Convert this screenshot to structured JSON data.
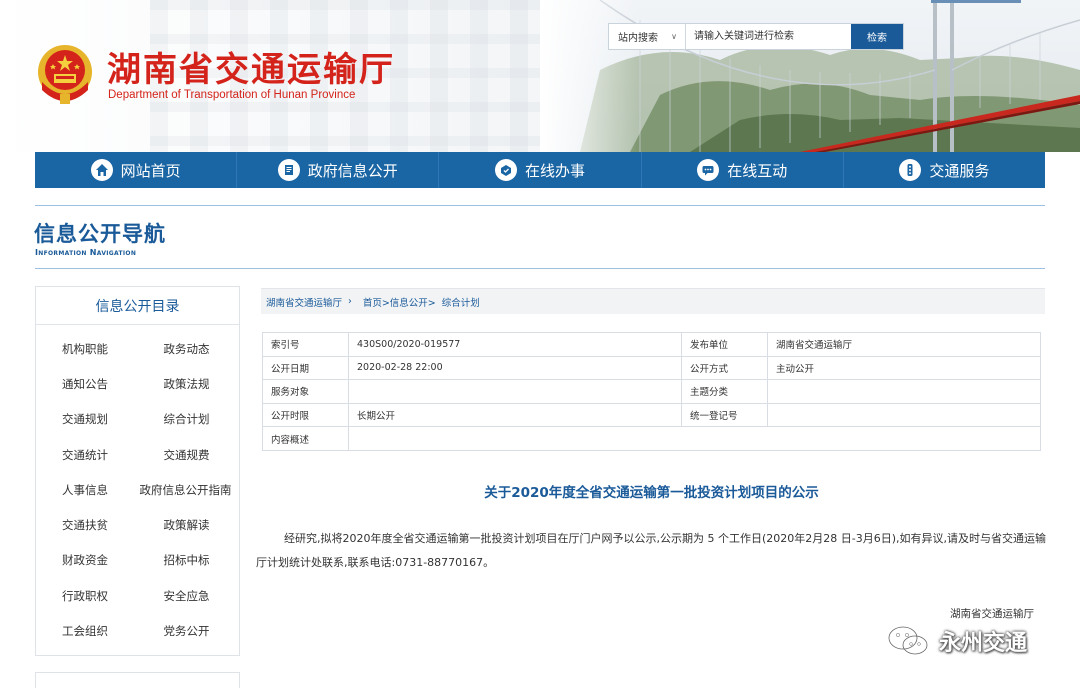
{
  "header": {
    "title": "湖南省交通运输厅",
    "subtitle": "Department of Transportation of Hunan Province"
  },
  "search": {
    "scope_label": "站内搜索",
    "placeholder": "请输入关键词进行检索",
    "button_label": "检索"
  },
  "nav": {
    "items": [
      {
        "label": "网站首页",
        "icon": "home-icon"
      },
      {
        "label": "政府信息公开",
        "icon": "document-icon"
      },
      {
        "label": "在线办事",
        "icon": "service-icon"
      },
      {
        "label": "在线互动",
        "icon": "chat-icon"
      },
      {
        "label": "交通服务",
        "icon": "traffic-light-icon"
      }
    ]
  },
  "section": {
    "title": "信息公开导航",
    "subtitle": "Information Navigation"
  },
  "sidebar": {
    "title": "信息公开目录",
    "items": [
      "机构职能",
      "政务动态",
      "通知公告",
      "政策法规",
      "交通规划",
      "综合计划",
      "交通统计",
      "交通规费",
      "人事信息",
      "政府信息公开指南",
      "交通扶贫",
      "政策解读",
      "财政资金",
      "招标中标",
      "行政职权",
      "安全应急",
      "工会组织",
      "党务公开"
    ]
  },
  "breadcrumb": {
    "items": [
      "湖南省交通运输厅",
      "首页>信息公开>  综合计划"
    ]
  },
  "info_table": {
    "rows": [
      {
        "k1": "索引号",
        "v1": "430S00/2020-019577",
        "k2": "发布单位",
        "v2": "湖南省交通运输厅"
      },
      {
        "k1": "公开日期",
        "v1": "2020-02-28 22:00",
        "k2": "公开方式",
        "v2": "主动公开"
      },
      {
        "k1": "服务对象",
        "v1": "",
        "k2": "主题分类",
        "v2": ""
      },
      {
        "k1": "公开时限",
        "v1": "长期公开",
        "k2": "统一登记号",
        "v2": ""
      },
      {
        "k1": "内容概述",
        "v1": "",
        "k2": "",
        "v2": ""
      }
    ]
  },
  "article": {
    "title": "关于2020年度全省交通运输第一批投资计划项目的公示",
    "body": "经研究,拟将2020年度全省交通运输第一批投资计划项目在厅门户网予以公示,公示期为 5 个工作日(2020年2月28 日-3月6日),如有异议,请及时与省交通运输厅计划统计处联系,联系电话:0731-88770167。",
    "signature": "湖南省交通运输厅"
  },
  "watermark": {
    "text": "永州交通"
  },
  "colors": {
    "brand_red": "#d4231a",
    "nav_blue": "#1a65a3",
    "link_blue": "#1a5a99"
  }
}
